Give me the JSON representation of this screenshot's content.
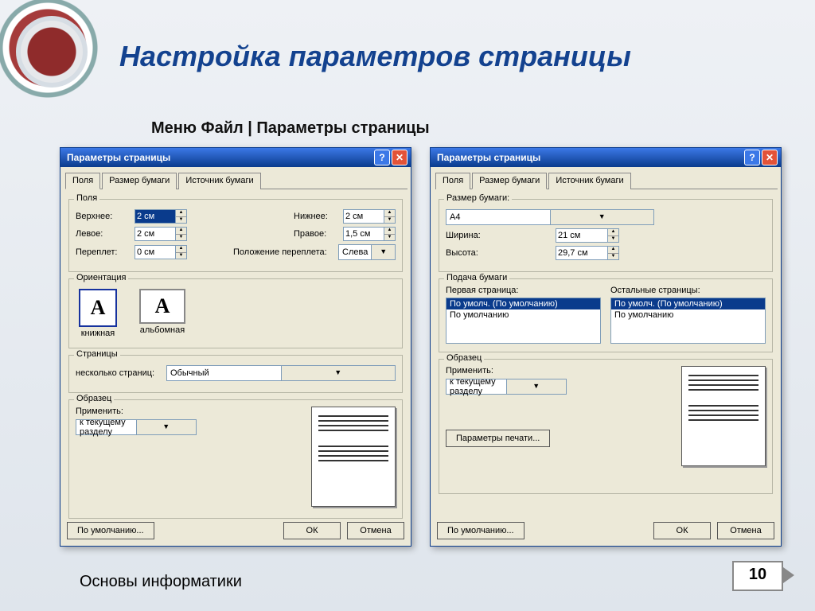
{
  "slide": {
    "title": "Настройка параметров страницы",
    "subtitle": "Меню Файл | Параметры страницы",
    "footer": "Основы информатики",
    "page_number": "10"
  },
  "dialog_left": {
    "title": "Параметры страницы",
    "tabs": [
      "Поля",
      "Размер бумаги",
      "Источник бумаги"
    ],
    "active_tab": 0,
    "margins": {
      "group_label": "Поля",
      "top_label": "Верхнее:",
      "top_value": "2 см",
      "bottom_label": "Нижнее:",
      "bottom_value": "2 см",
      "left_label": "Левое:",
      "left_value": "2 см",
      "right_label": "Правое:",
      "right_value": "1,5 см",
      "gutter_label": "Переплет:",
      "gutter_value": "0 см",
      "gutter_pos_label": "Положение переплета:",
      "gutter_pos_value": "Слева"
    },
    "orientation": {
      "group_label": "Ориентация",
      "portrait": "книжная",
      "landscape": "альбомная"
    },
    "pages": {
      "group_label": "Страницы",
      "multi_label": "несколько страниц:",
      "multi_value": "Обычный"
    },
    "sample": {
      "group_label": "Образец",
      "apply_label": "Применить:",
      "apply_value": "к текущему разделу"
    },
    "buttons": {
      "default": "По умолчанию...",
      "ok": "ОК",
      "cancel": "Отмена"
    }
  },
  "dialog_right": {
    "title": "Параметры страницы",
    "tabs": [
      "Поля",
      "Размер бумаги",
      "Источник бумаги"
    ],
    "active_tab": 1,
    "paper": {
      "group_label": "Размер бумаги:",
      "size_value": "A4",
      "width_label": "Ширина:",
      "width_value": "21 см",
      "height_label": "Высота:",
      "height_value": "29,7 см"
    },
    "source": {
      "group_label": "Подача бумаги",
      "first_label": "Первая страница:",
      "other_label": "Остальные страницы:",
      "items": [
        "По умолч. (По умолчанию)",
        "По умолчанию"
      ]
    },
    "sample": {
      "group_label": "Образец",
      "apply_label": "Применить:",
      "apply_value": "к текущему разделу",
      "print_btn": "Параметры печати..."
    },
    "buttons": {
      "default": "По умолчанию...",
      "ok": "ОК",
      "cancel": "Отмена"
    }
  }
}
